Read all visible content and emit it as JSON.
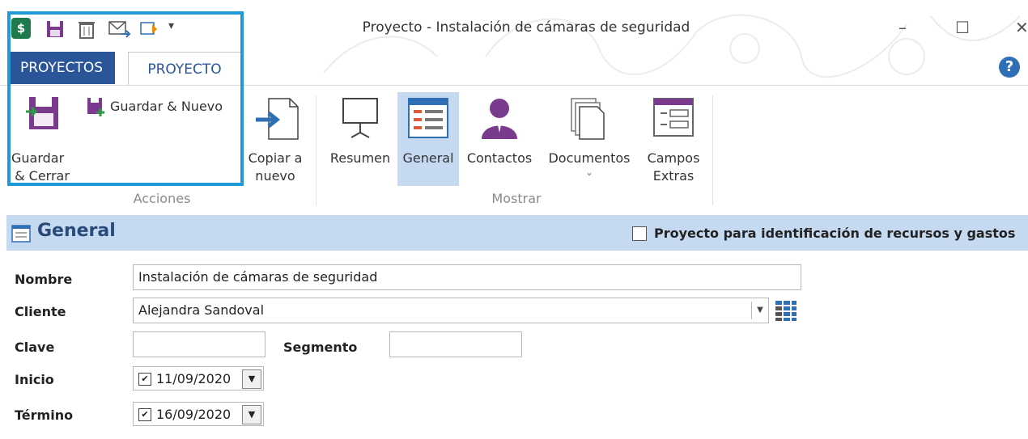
{
  "window": {
    "title": "Proyecto - Instalación de cámaras de seguridad",
    "minimize_glyph": "–",
    "maximize_glyph": "☐",
    "close_glyph": "✕",
    "help_glyph": "?"
  },
  "qat": {
    "qat_more_glyph": "▾"
  },
  "tabs": [
    {
      "label": "PROYECTOS"
    },
    {
      "label": "PROYECTO"
    }
  ],
  "ribbon": {
    "acciones": {
      "group_label": "Acciones",
      "guardar_cerrar_l1": "Guardar",
      "guardar_cerrar_l2": "& Cerrar",
      "guardar_nuevo": "Guardar & Nuevo",
      "copiar_l1": "Copiar a",
      "copiar_l2": "nuevo"
    },
    "mostrar": {
      "group_label": "Mostrar",
      "resumen": "Resumen",
      "general": "General",
      "contactos": "Contactos",
      "documentos": "Documentos",
      "documentos_arrow": "ˇ",
      "campos_l1": "Campos",
      "campos_l2": "Extras"
    }
  },
  "general": {
    "title": "General",
    "recursos_label": "Proyecto para identificación de recursos y gastos",
    "nombre_label": "Nombre",
    "nombre_value": "Instalación de cámaras de seguridad",
    "cliente_label": "Cliente",
    "cliente_value": "Alejandra Sandoval",
    "clave_label": "Clave",
    "clave_value": "",
    "segmento_label": "Segmento",
    "segmento_value": "",
    "inicio_label": "Inicio",
    "inicio_value": "11/09/2020",
    "termino_label": "Término",
    "termino_value": "16/09/2020",
    "check_glyph": "✔",
    "dropdown_glyph": "▼"
  },
  "colors": {
    "accent_blue": "#2a5599",
    "highlight_border": "#1f9ad6",
    "section_header": "#c5d9f1",
    "icon_purple": "#7a3b8f"
  }
}
